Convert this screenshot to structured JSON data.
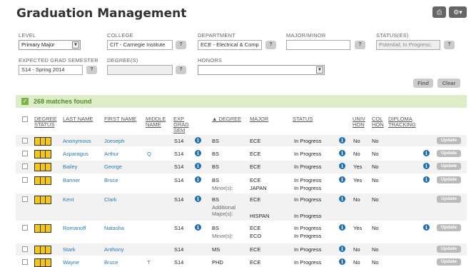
{
  "page_title": "Graduation Management",
  "icons": {
    "print": "printer-icon",
    "settings": "gear-icon"
  },
  "filters": {
    "level_label": "LEVEL",
    "level_value": "Primary Major",
    "college_label": "COLLEGE",
    "college_value": "CIT - Carnegie Institute",
    "department_label": "DEPARTMENT",
    "department_value": "ECE - Electrical & Comp",
    "major_label": "MAJOR/MINOR",
    "major_value": "",
    "status_label": "STATUS(ES)",
    "status_value": "Potential; In Progress;",
    "egs_label": "EXPECTED GRAD SEMESTER",
    "egs_value": "S14 - Spring 2014",
    "degrees_label": "DEGREE(S)",
    "degrees_value": "",
    "honors_label": "HONORS",
    "honors_value": "",
    "help": "?"
  },
  "actions": {
    "find": "Find",
    "clear": "Clear"
  },
  "matches_text": "268 matches found",
  "headers": {
    "status1": "DEGREE",
    "status2": "STATUS",
    "last": "LAST NAME",
    "first": "FIRST NAME",
    "middle1": "MIDDLE",
    "middle2": "NAME",
    "exp1": "EXP",
    "exp2": "GRAD",
    "exp3": "SEM",
    "degree": "▲ DEGREE",
    "major": "MAJOR",
    "status": "STATUS",
    "univ1": "UNIV",
    "univ2": "HON",
    "col1": "COL",
    "col2": "HON",
    "dip1": "DIPLOMA",
    "dip2": "TRACKING"
  },
  "update_label": "Update",
  "info_glyph": "i",
  "rows": [
    {
      "last": "Anonymous",
      "first": "Joeseph",
      "middle": "",
      "sem": "S14",
      "degree": "BS",
      "degree_sub": "",
      "major": "ECE",
      "major_sub": "",
      "status": "In Progress",
      "status_sub": "",
      "univ": "No",
      "col": "No",
      "dip_info": false,
      "sem_info": true
    },
    {
      "last": "Asparagus",
      "first": "Arthur",
      "middle": "Q",
      "sem": "S14",
      "degree": "BS",
      "degree_sub": "",
      "major": "ECE",
      "major_sub": "",
      "status": "In Progress",
      "status_sub": "",
      "univ": "No",
      "col": "No",
      "dip_info": true,
      "sem_info": true
    },
    {
      "last": "Bailey",
      "first": "George",
      "middle": "",
      "sem": "S14",
      "degree": "BS",
      "degree_sub": "",
      "major": "ECE",
      "major_sub": "",
      "status": "In Progress",
      "status_sub": "",
      "univ": "Yes",
      "col": "No",
      "dip_info": true,
      "sem_info": true
    },
    {
      "last": "Banner",
      "first": "Bruce",
      "middle": "",
      "sem": "S14",
      "degree": "BS",
      "degree_sub": "Minor(s):",
      "major": "ECE",
      "major_sub": "JAPAN",
      "status": "In Progress",
      "status_sub": "In Progress",
      "univ": "Yes",
      "col": "No",
      "dip_info": true,
      "sem_info": true
    },
    {
      "last": "Kent",
      "first": "Clark",
      "middle": "",
      "sem": "S14",
      "degree": "BS",
      "degree_sub": "Additional Major(s):",
      "major": "ECE",
      "major_sub": "HISPAN",
      "status": "In Progress",
      "status_sub": "In Progress",
      "univ": "No",
      "col": "No",
      "dip_info": false,
      "sem_info": true
    },
    {
      "last": "Romanoff",
      "first": "Natasha",
      "middle": "",
      "sem": "S14",
      "degree": "BS",
      "degree_sub": "Minor(s):",
      "major": "ECE",
      "major_sub": "ECO",
      "status": "In Progress",
      "status_sub": "In Progress",
      "univ": "Yes",
      "col": "No",
      "dip_info": true,
      "sem_info": true
    },
    {
      "last": "Stark",
      "first": "Anthony",
      "middle": "",
      "sem": "S14",
      "degree": "MS",
      "degree_sub": "",
      "major": "ECE",
      "major_sub": "",
      "status": "In Progress",
      "status_sub": "",
      "univ": "No",
      "col": "No",
      "dip_info": false,
      "sem_info": false
    },
    {
      "last": "Wayne",
      "first": "Bruce",
      "middle": "T",
      "sem": "S14",
      "degree": "PHD",
      "degree_sub": "",
      "major": "ECE",
      "major_sub": "",
      "status": "In Progress",
      "status_sub": "",
      "univ": "No",
      "col": "No",
      "dip_info": false,
      "sem_info": false
    }
  ]
}
